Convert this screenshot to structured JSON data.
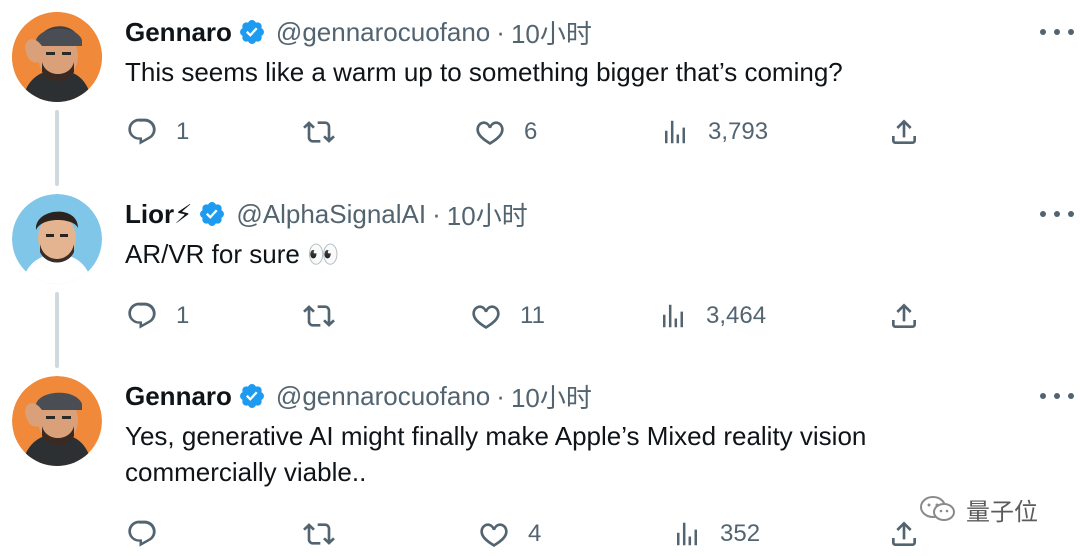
{
  "tweets": [
    {
      "name": "Gennaro",
      "handle": "@gennarocuofano",
      "separator": "·",
      "time": "10小时",
      "lines": [
        "This seems like a warm up to something bigger that’s coming?"
      ],
      "replies": "1",
      "retweets": "",
      "likes": "6",
      "views": "3,793"
    },
    {
      "name": "Lior⚡",
      "handle": "@AlphaSignalAI",
      "separator": "·",
      "time": "10小时",
      "lines": [
        "AR/VR for sure 👀"
      ],
      "replies": "1",
      "retweets": "",
      "likes": "11",
      "views": "3,464"
    },
    {
      "name": "Gennaro",
      "handle": "@gennarocuofano",
      "separator": "·",
      "time": "10小时",
      "lines": [
        "Yes, generative AI might finally make Apple’s Mixed reality vision",
        "commercially viable.."
      ],
      "replies": "",
      "retweets": "",
      "likes": "4",
      "views": "352"
    }
  ],
  "watermark": "量子位",
  "icons": {
    "verified": "verified-badge-icon",
    "more": "more-options-icon",
    "reply": "reply-icon",
    "retweet": "retweet-icon",
    "like": "heart-icon",
    "views": "views-bar-chart-icon",
    "share": "share-icon",
    "watermark": "wechat-icon"
  },
  "colors": {
    "verified_blue": "#1d9bf0",
    "text_primary": "#0f1419",
    "text_secondary": "#536471",
    "thread_line": "#cfd9de"
  }
}
